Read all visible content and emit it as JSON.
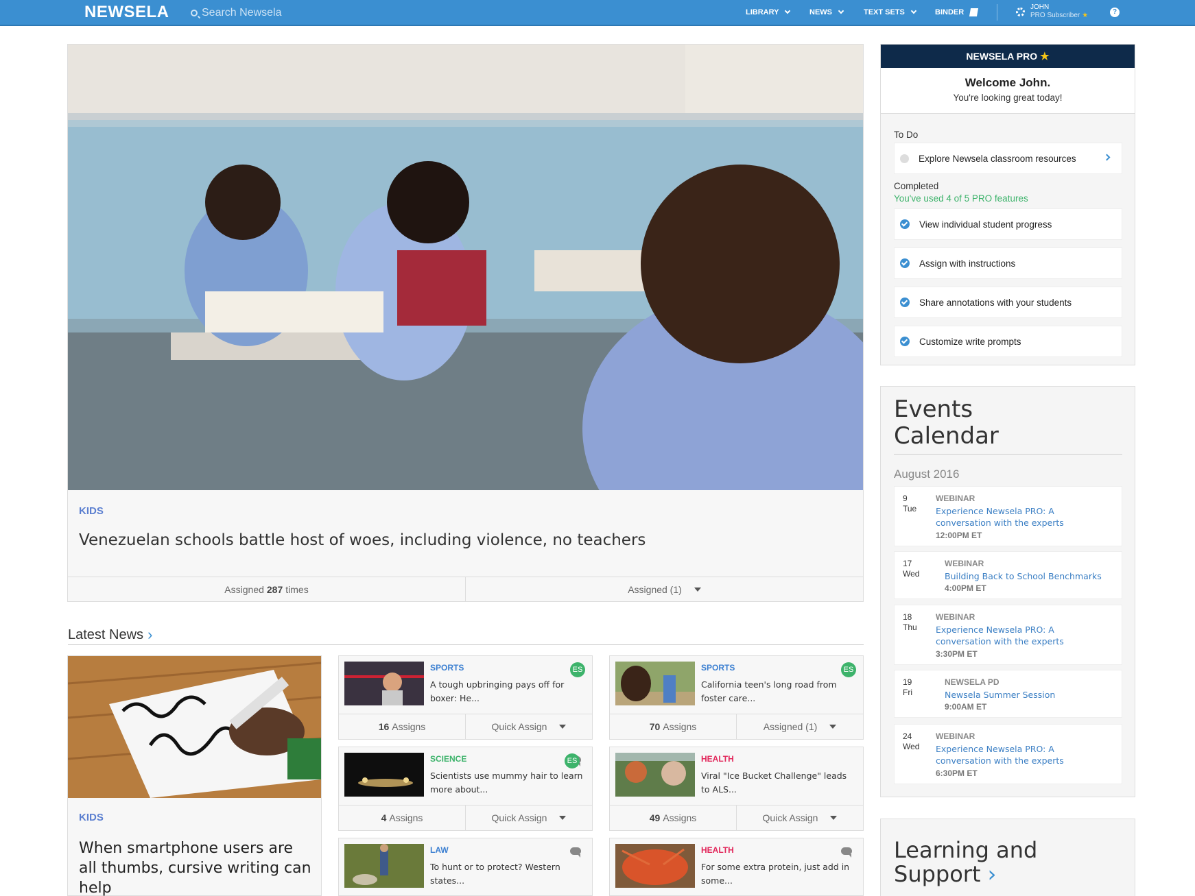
{
  "header": {
    "logo": "NEWSELA",
    "search_placeholder": "Search Newsela",
    "nav": [
      "LIBRARY",
      "NEWS",
      "TEXT SETS",
      "BINDER"
    ],
    "user_name": "JOHN",
    "user_role": "PRO Subscriber"
  },
  "hero": {
    "category": "KIDS",
    "title": "Venezuelan schools battle host of woes, including violence, no teachers",
    "assigned_prefix": "Assigned",
    "assigned_count": "287",
    "assigned_suffix": "times",
    "assigned_dropdown": "Assigned (1)"
  },
  "latest_news": {
    "heading": "Latest News",
    "featured": {
      "category": "KIDS",
      "title": "When smartphone users are all thumbs, cursive writing can help"
    },
    "cards": [
      {
        "category": "SPORTS",
        "category_color": "#3b7fd1",
        "title": "A tough upbringing pays off for boxer: He...",
        "badge": "ES",
        "comment": false,
        "assigns": "16",
        "action": "Quick Assign"
      },
      {
        "category": "SPORTS",
        "category_color": "#3b7fd1",
        "title": "California teen's long road from foster care...",
        "badge": "ES",
        "comment": false,
        "assigns": "70",
        "action": "Assigned (1)"
      },
      {
        "category": "SCIENCE",
        "category_color": "#3db36b",
        "title": "Scientists use mummy hair to learn more about...",
        "badge": "ES",
        "comment": true,
        "assigns": "4",
        "action": "Quick Assign"
      },
      {
        "category": "HEALTH",
        "category_color": "#e2265a",
        "title": "Viral \"Ice Bucket Challenge\" leads to ALS...",
        "badge": "",
        "comment": false,
        "assigns": "49",
        "action": "Quick Assign"
      },
      {
        "category": "LAW",
        "category_color": "#3b7fd1",
        "title": "To hunt or to protect? Western states...",
        "badge": "",
        "comment": true
      },
      {
        "category": "HEALTH",
        "category_color": "#e2265a",
        "title": "For some extra protein, just add in some...",
        "badge": "",
        "comment": true
      }
    ],
    "assigns_label": "Assigns"
  },
  "pro_panel": {
    "title": "NEWSELA PRO",
    "welcome": "Welcome John.",
    "greeting": "You're looking great today!",
    "todo_label": "To Do",
    "todo_items": [
      "Explore Newsela classroom resources"
    ],
    "completed_label": "Completed",
    "completed_sub": "You've used 4 of 5 PRO features",
    "completed_items": [
      "View individual student progress",
      "Assign with instructions",
      "Share annotations with your students",
      "Customize write prompts"
    ]
  },
  "events": {
    "title_line1": "Events",
    "title_line2": "Calendar",
    "month": "August 2016",
    "items": [
      {
        "day": "9",
        "weekday": "Tue",
        "type": "WEBINAR",
        "title": "Experience Newsela PRO: A conversation with the experts",
        "time": "12:00PM ET"
      },
      {
        "day": "17",
        "weekday": "Wed",
        "type": "WEBINAR",
        "title": "Building Back to School Benchmarks",
        "time": "4:00PM ET"
      },
      {
        "day": "18",
        "weekday": "Thu",
        "type": "WEBINAR",
        "title": "Experience Newsela PRO: A conversation with the experts",
        "time": "3:30PM ET"
      },
      {
        "day": "19",
        "weekday": "Fri",
        "type": "NEWSELA PD",
        "title": "Newsela Summer Session",
        "time": "9:00AM ET"
      },
      {
        "day": "24",
        "weekday": "Wed",
        "type": "WEBINAR",
        "title": "Experience Newsela PRO: A conversation with the experts",
        "time": "6:30PM ET"
      }
    ]
  },
  "learning": {
    "title_line1": "Learning and",
    "title_line2": "Support"
  },
  "colors": {
    "brand": "#3b8fd1",
    "pro_header": "#0e2a4a",
    "success": "#3db36b"
  }
}
